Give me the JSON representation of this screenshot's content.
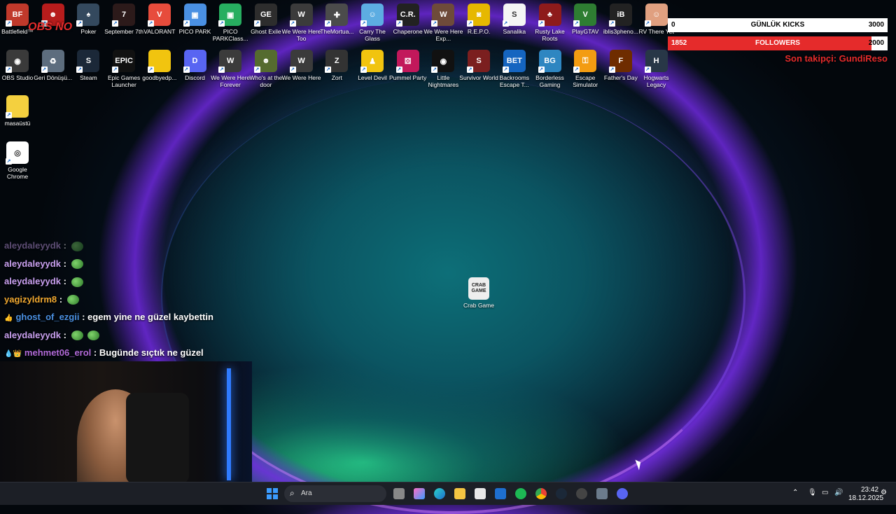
{
  "desktop": {
    "row1": [
      {
        "label": "Battlefield™",
        "color": "#c0392b",
        "glyph": "BF"
      },
      {
        "label": "",
        "color": "#b71c1c",
        "glyph": "☻"
      },
      {
        "label": "Poker",
        "color": "#34495e",
        "glyph": "♠"
      },
      {
        "label": "September 7th",
        "color": "#2c1a1a",
        "glyph": "7"
      },
      {
        "label": "VALORANT",
        "color": "#e74c3c",
        "glyph": "V"
      },
      {
        "label": "PICO PARK",
        "color": "#4a90e2",
        "glyph": "▣"
      },
      {
        "label": "PICO PARKClass...",
        "color": "#27ae60",
        "glyph": "▣"
      },
      {
        "label": "Ghost Exile",
        "color": "#2d2d2d",
        "glyph": "GE"
      },
      {
        "label": "We Were Here Too",
        "color": "#3b3b3b",
        "glyph": "W"
      },
      {
        "label": "TheMortua...",
        "color": "#4b4b4b",
        "glyph": "✚"
      },
      {
        "label": "Carry The Glass",
        "color": "#5dade2",
        "glyph": "☺"
      },
      {
        "label": "Chaperone",
        "color": "#222",
        "glyph": "C.R."
      },
      {
        "label": "We Were Here Exp...",
        "color": "#6e4b3a",
        "glyph": "W"
      },
      {
        "label": "R.E.P.O.",
        "color": "#e6b800",
        "glyph": "◙"
      },
      {
        "label": "Sanalika",
        "color": "#f5f5f5",
        "glyph": "S"
      },
      {
        "label": "Rusty Lake Roots",
        "color": "#8e1b1b",
        "glyph": "♣"
      },
      {
        "label": "PlayGTAV",
        "color": "#2e7d32",
        "glyph": "V"
      },
      {
        "label": "iblis3pheno...",
        "color": "#222",
        "glyph": "iB"
      },
      {
        "label": "RV There Yet",
        "color": "#e0a080",
        "glyph": "☺"
      }
    ],
    "row2": [
      {
        "label": "OBS Studio",
        "color": "#3a3a3a",
        "glyph": "◉"
      },
      {
        "label": "Geri Dönüşü...",
        "color": "#5d6d7e",
        "glyph": "♻"
      },
      {
        "label": "Steam",
        "color": "#1b2838",
        "glyph": "S"
      },
      {
        "label": "Epic Games Launcher",
        "color": "#111",
        "glyph": "EPIC"
      },
      {
        "label": "goodbyedp...",
        "color": "#f1c40f",
        "glyph": ""
      },
      {
        "label": "Discord",
        "color": "#5865f2",
        "glyph": "D"
      },
      {
        "label": "We Were Here Forever",
        "color": "#3b3b3b",
        "glyph": "W"
      },
      {
        "label": "Who's at the door",
        "color": "#556b2f",
        "glyph": "☻"
      },
      {
        "label": "We Were Here",
        "color": "#3b3b3b",
        "glyph": "W"
      },
      {
        "label": "Zort",
        "color": "#333",
        "glyph": "Z"
      },
      {
        "label": "Level Devil",
        "color": "#f1c40f",
        "glyph": "♟"
      },
      {
        "label": "Pummel Party",
        "color": "#c2185b",
        "glyph": "⚄"
      },
      {
        "label": "Little Nightmares",
        "color": "#111",
        "glyph": "◉"
      },
      {
        "label": "Survivor World",
        "color": "#7b1f1f",
        "glyph": "S"
      },
      {
        "label": "Backrooms Escape T...",
        "color": "#1565c0",
        "glyph": "BET"
      },
      {
        "label": "Borderless Gaming",
        "color": "#2e86c1",
        "glyph": "BG"
      },
      {
        "label": "Escape Simulator",
        "color": "#f39c12",
        "glyph": "⚿"
      },
      {
        "label": "Father's Day",
        "color": "#6e2c00",
        "glyph": "F"
      },
      {
        "label": "Hogwarts Legacy",
        "color": "#283747",
        "glyph": "H"
      }
    ],
    "col1": [
      {
        "label": "masaüstü",
        "color": "#f4d03f",
        "glyph": ""
      },
      {
        "label": "Google Chrome",
        "color": "#fff",
        "glyph": "◎"
      }
    ],
    "center_icon": {
      "label": "Crab Game",
      "glyph": "CRAB GAME"
    }
  },
  "overlay": {
    "logo_text": "OBS NO",
    "kicks": {
      "left": "0",
      "center": "GÜNLÜK KICKS",
      "right": "3000",
      "color": "#ffffff"
    },
    "followers": {
      "left": "1852",
      "center": "FOLLOWERS",
      "right": "2000",
      "color": "#e52b2b",
      "progress": 0.926
    },
    "last_follower": "Son takipçi: GundiReso"
  },
  "chat": [
    {
      "user": "aleydaleyydk",
      "color": "#c9a0f0",
      "msg": "",
      "emotes": 1,
      "faded": true
    },
    {
      "user": "aleydaleyydk",
      "color": "#c9a0f0",
      "msg": "",
      "emotes": 1
    },
    {
      "user": "aleydaleyydk",
      "color": "#c9a0f0",
      "msg": "",
      "emotes": 1
    },
    {
      "user": "yagizyldrm8",
      "color": "#f0a830",
      "msg": "",
      "emotes": 1
    },
    {
      "user": "ghost_of_ezgii",
      "color": "#4a90e2",
      "msg": "egem yine ne güzel kaybettin",
      "emotes": 0,
      "badge": "👍"
    },
    {
      "user": "aleydaleyydk",
      "color": "#c9a0f0",
      "msg": "",
      "emotes": 2
    },
    {
      "user": "mehmet06_erol",
      "color": "#b06ad8",
      "msg": "Bugünde sıçtık ne güzel",
      "emotes": 0,
      "badge": "💧👑"
    }
  ],
  "taskbar": {
    "search_placeholder": "Ara",
    "time": "23:42",
    "date": "18.12.2025"
  }
}
